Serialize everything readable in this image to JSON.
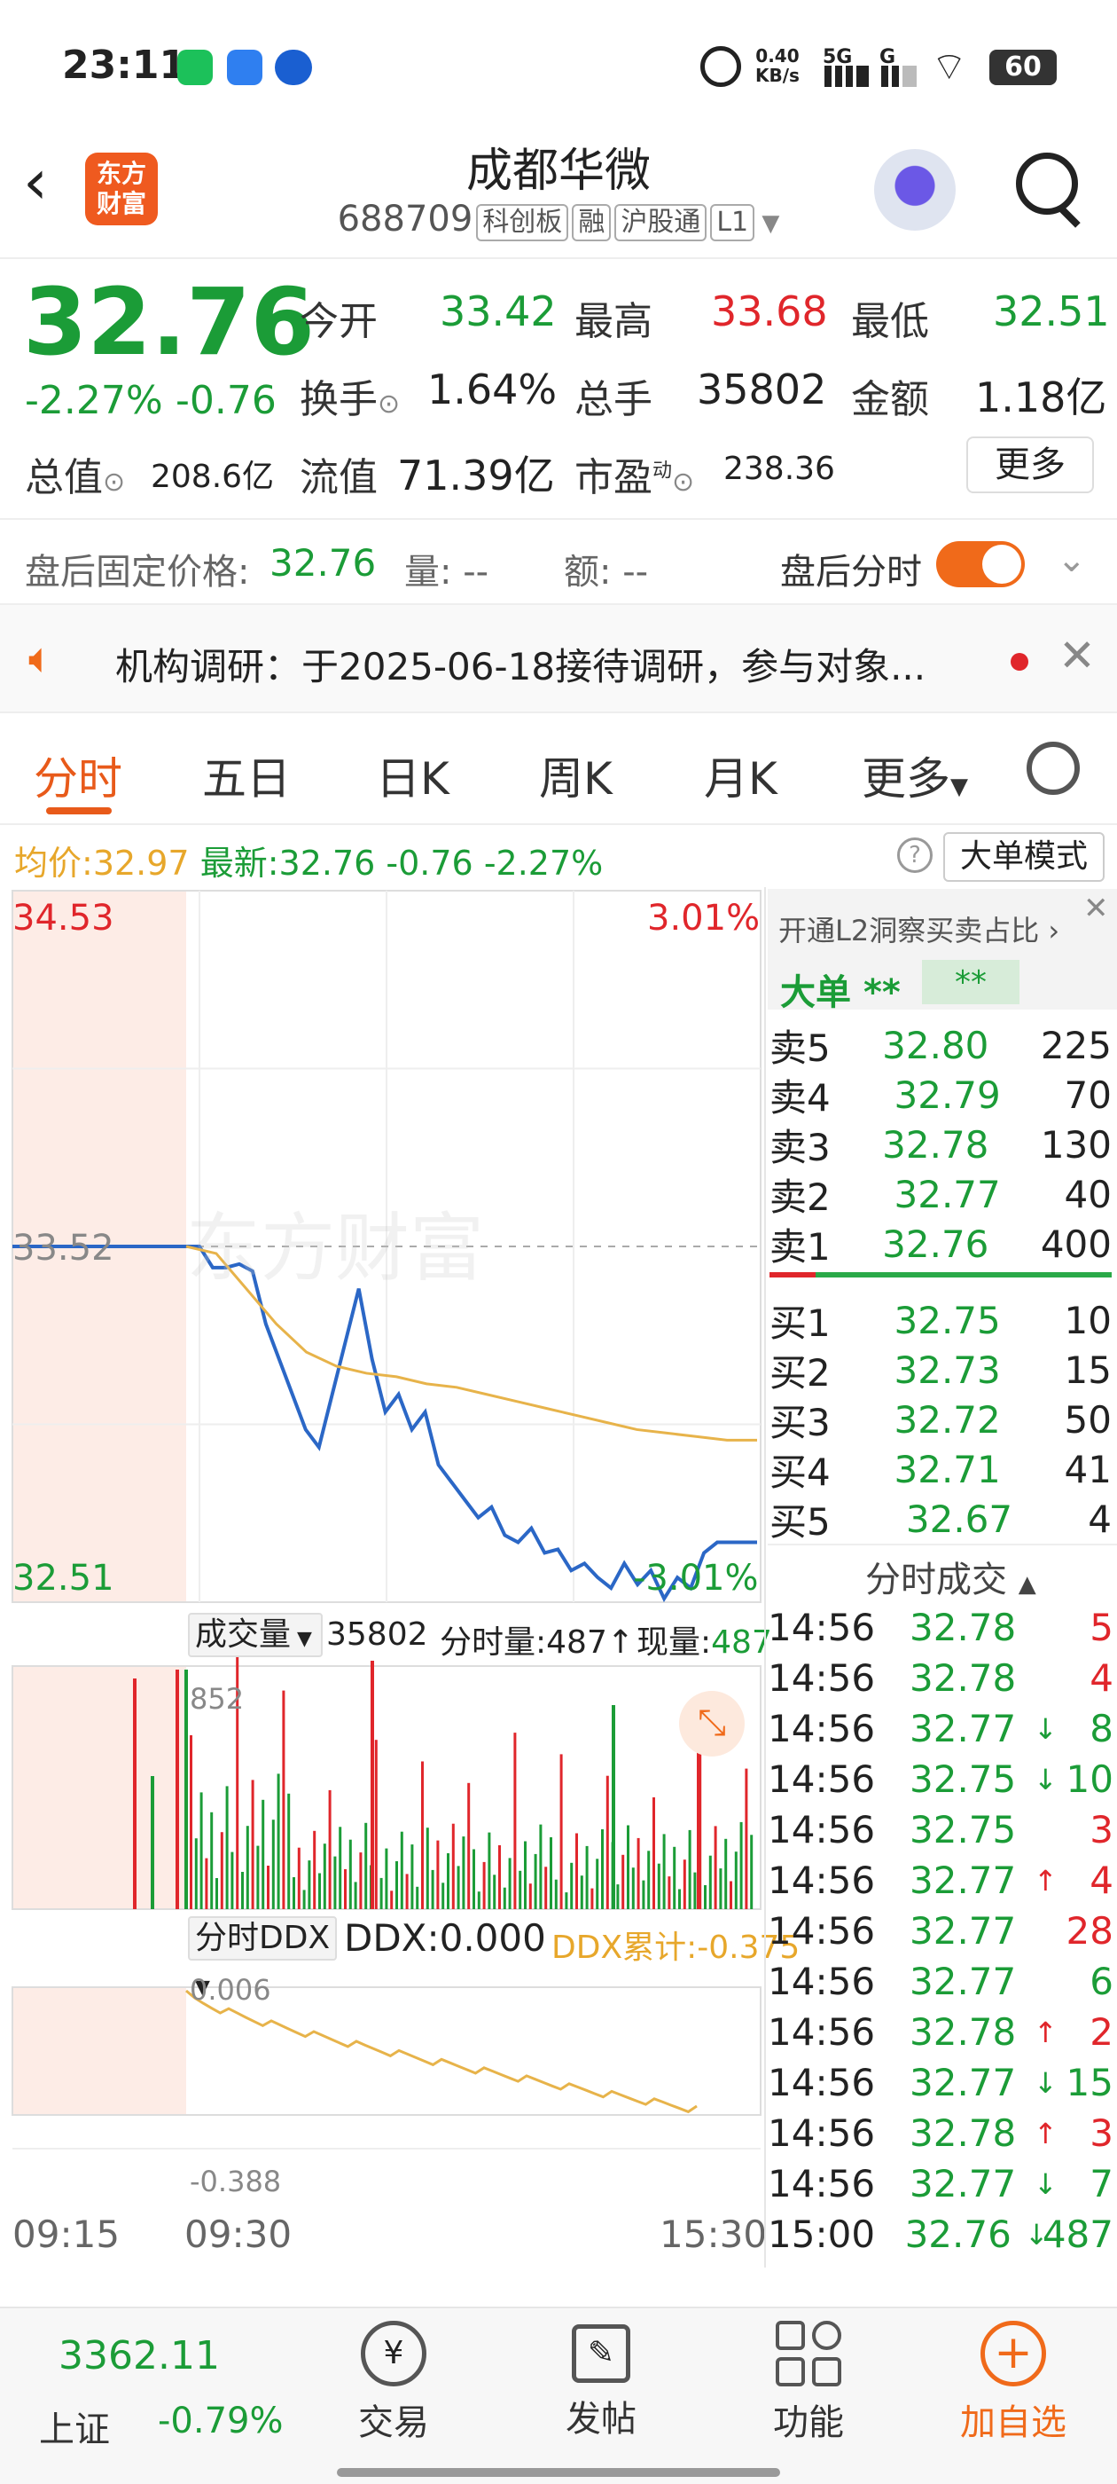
{
  "status_bar": {
    "time": "23:11",
    "net_speed_top": "0.40",
    "net_speed_bottom": "KB/s",
    "net1": "5G",
    "net2": "G",
    "battery": "60"
  },
  "header": {
    "logo_text_1": "东方",
    "logo_text_2": "财富",
    "stock_name": "成都华微",
    "stock_code": "688709",
    "badges": [
      "科创板",
      "融",
      "沪股通",
      "L1"
    ]
  },
  "quote": {
    "price": "32.76",
    "change_pct": "-2.27%",
    "change": "-0.76",
    "open_label": "今开",
    "open": "33.42",
    "high_label": "最高",
    "high": "33.68",
    "low_label": "最低",
    "low": "32.51",
    "turnover_label": "换手",
    "turnover": "1.64%",
    "volume_label": "总手",
    "volume": "35802",
    "amount_label": "金额",
    "amount": "1.18亿",
    "mktcap_label": "总值",
    "mktcap": "208.6亿",
    "float_label": "流值",
    "float_cap": "71.39亿",
    "pe_label": "市盈",
    "pe_sup": "动",
    "pe": "238.36",
    "more_button": "更多"
  },
  "after_hours": {
    "label": "盘后固定价格:",
    "price": "32.76",
    "vol_label": "量: --",
    "amt_label": "额: --",
    "toggle_label": "盘后分时"
  },
  "notice": {
    "text": "机构调研：于2025-06-18接待调研，参与对象..."
  },
  "tabs": [
    "分时",
    "五日",
    "日K",
    "周K",
    "月K",
    "更多"
  ],
  "info_line": {
    "avg_label": "均价:",
    "avg": "32.97",
    "latest_label": "最新:",
    "latest": "32.76",
    "change": "-0.76",
    "change_pct": "-2.27%",
    "mode_button": "大单模式"
  },
  "chart_data": {
    "type": "line",
    "price_axis": {
      "top": "34.53",
      "mid": "33.52",
      "bottom": "32.51"
    },
    "pct_axis": {
      "top": "3.01%",
      "bottom": "-3.01%"
    },
    "x_ticks": [
      "09:15",
      "09:30",
      "15:30"
    ],
    "volume_panel": {
      "label": "成交量",
      "total": "35802",
      "min_label": "分时量:487",
      "now_label": "现量:",
      "now": "487",
      "max": "852"
    },
    "ddx_panel": {
      "label": "分时DDX",
      "ddx_label": "DDX:",
      "ddx": "0.000",
      "cum_label": "DDX累计:",
      "cum": "-0.375",
      "top": "0.006",
      "bottom": "-0.388"
    },
    "series": [
      {
        "name": "最新",
        "values": [
          33.52,
          33.52,
          33.46,
          33.46,
          33.47,
          33.45,
          33.3,
          33.2,
          33.1,
          33.0,
          32.95,
          33.1,
          33.25,
          33.4,
          33.2,
          33.05,
          33.1,
          33.0,
          33.05,
          32.9,
          32.85,
          32.8,
          32.75,
          32.78,
          32.7,
          32.68,
          32.72,
          32.65,
          32.66,
          32.6,
          32.62,
          32.58,
          32.55,
          32.62,
          32.56,
          32.6,
          32.52,
          32.58,
          32.55,
          32.65,
          32.68,
          32.68,
          32.68,
          32.68
        ]
      },
      {
        "name": "均价",
        "values": [
          33.52,
          33.5,
          33.4,
          33.3,
          33.22,
          33.18,
          33.16,
          33.15,
          33.13,
          33.12,
          33.1,
          33.08,
          33.06,
          33.04,
          33.02,
          33.0,
          32.99,
          32.98,
          32.97,
          32.97
        ]
      }
    ]
  },
  "orderbook": {
    "l2_link": "开通L2洞察买卖占比",
    "big_order": "大单",
    "big_val1": "**",
    "big_val2": "**",
    "asks": [
      {
        "label": "卖5",
        "price": "32.80",
        "vol": "225"
      },
      {
        "label": "卖4",
        "price": "32.79",
        "vol": "70"
      },
      {
        "label": "卖3",
        "price": "32.78",
        "vol": "130"
      },
      {
        "label": "卖2",
        "price": "32.77",
        "vol": "40"
      },
      {
        "label": "卖1",
        "price": "32.76",
        "vol": "400"
      }
    ],
    "bids": [
      {
        "label": "买1",
        "price": "32.75",
        "vol": "10"
      },
      {
        "label": "买2",
        "price": "32.73",
        "vol": "15"
      },
      {
        "label": "买3",
        "price": "32.72",
        "vol": "50"
      },
      {
        "label": "买4",
        "price": "32.71",
        "vol": "41"
      },
      {
        "label": "买5",
        "price": "32.67",
        "vol": "4"
      }
    ]
  },
  "trades": {
    "title": "分时成交",
    "rows": [
      {
        "time": "14:56",
        "price": "32.78",
        "arrow": "",
        "vol": "5",
        "vc": "red"
      },
      {
        "time": "14:56",
        "price": "32.78",
        "arrow": "",
        "vol": "4",
        "vc": "red"
      },
      {
        "time": "14:56",
        "price": "32.77",
        "arrow": "↓",
        "vol": "8",
        "vc": "green"
      },
      {
        "time": "14:56",
        "price": "32.75",
        "arrow": "↓",
        "vol": "10",
        "vc": "green"
      },
      {
        "time": "14:56",
        "price": "32.75",
        "arrow": "",
        "vol": "3",
        "vc": "red"
      },
      {
        "time": "14:56",
        "price": "32.77",
        "arrow": "↑",
        "vol": "4",
        "vc": "red"
      },
      {
        "time": "14:56",
        "price": "32.77",
        "arrow": "",
        "vol": "28",
        "vc": "red"
      },
      {
        "time": "14:56",
        "price": "32.77",
        "arrow": "",
        "vol": "6",
        "vc": "green"
      },
      {
        "time": "14:56",
        "price": "32.78",
        "arrow": "↑",
        "vol": "2",
        "vc": "red"
      },
      {
        "time": "14:56",
        "price": "32.77",
        "arrow": "↓",
        "vol": "15",
        "vc": "green"
      },
      {
        "time": "14:56",
        "price": "32.78",
        "arrow": "↑",
        "vol": "3",
        "vc": "red"
      },
      {
        "time": "14:56",
        "price": "32.77",
        "arrow": "↓",
        "vol": "7",
        "vc": "green"
      },
      {
        "time": "15:00",
        "price": "32.76",
        "arrow": "↓",
        "vol": "487",
        "vc": "green"
      }
    ]
  },
  "bottom_nav": {
    "index_value": "3362.11",
    "index_name": "上证",
    "index_change": "-0.79%",
    "items": [
      "交易",
      "发帖",
      "功能",
      "加自选"
    ]
  },
  "watermark": "东方财富"
}
